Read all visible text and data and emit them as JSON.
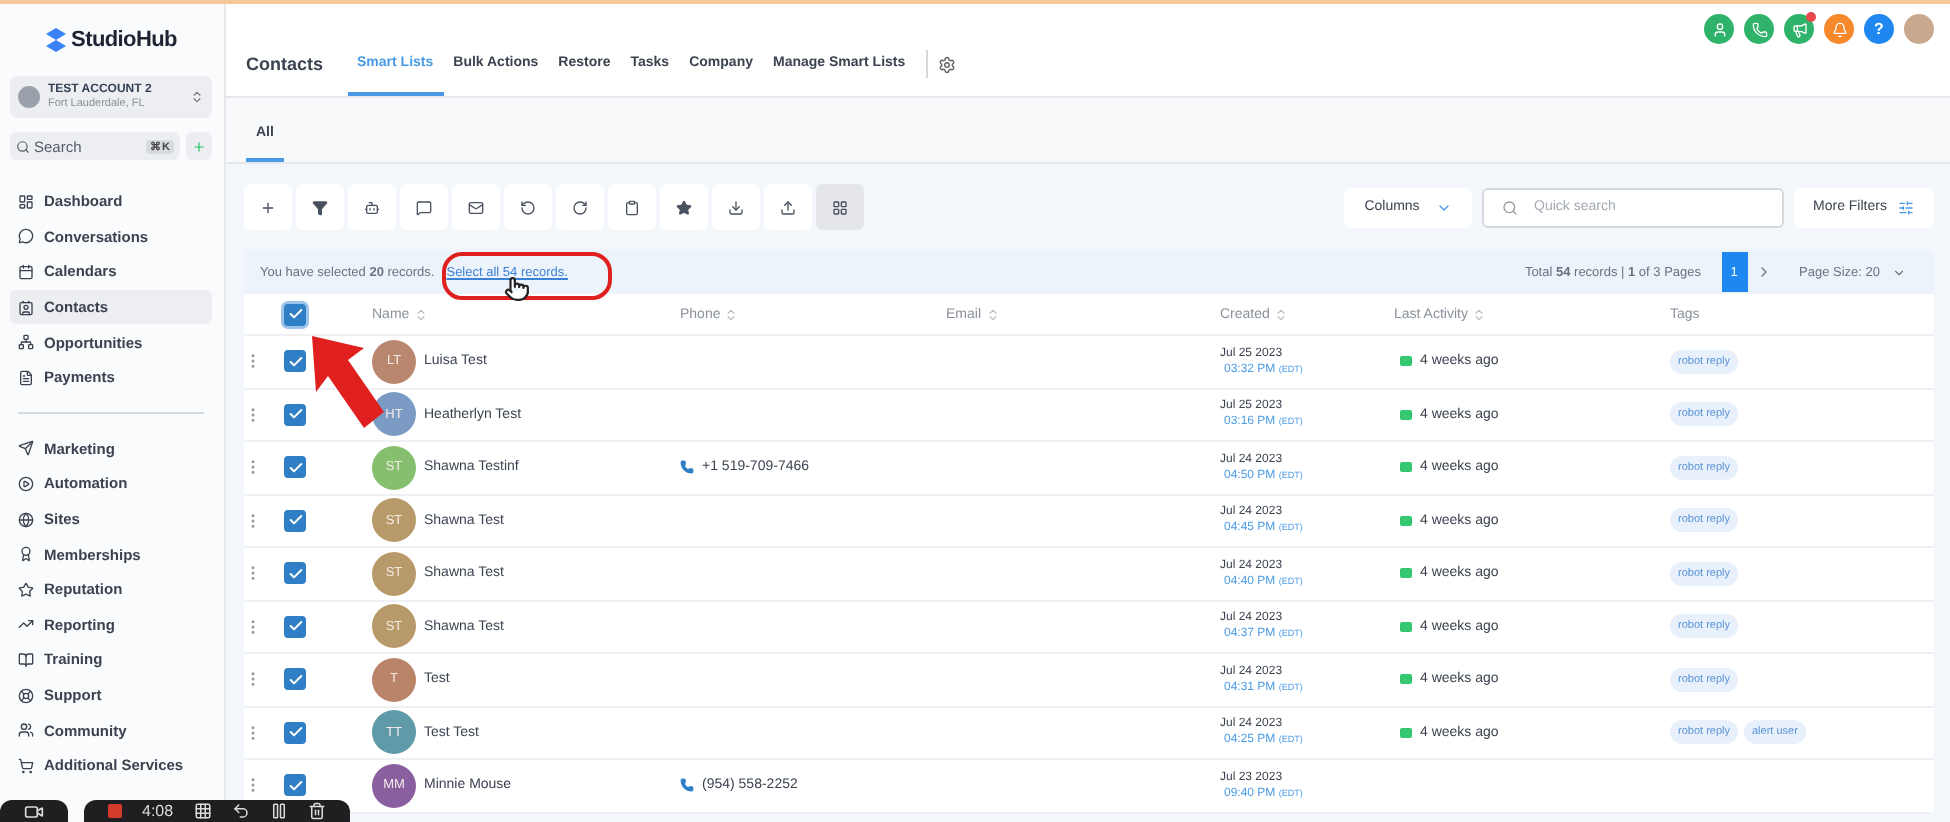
{
  "sidebar": {
    "brand": "StudioHub",
    "account": {
      "name": "TEST ACCOUNT 2",
      "location": "Fort Lauderdale, FL"
    },
    "search": {
      "placeholder": "Search",
      "shortcut": "⌘K"
    },
    "items": [
      {
        "label": "Dashboard",
        "selected": false
      },
      {
        "label": "Conversations",
        "selected": false
      },
      {
        "label": "Calendars",
        "selected": false
      },
      {
        "label": "Contacts",
        "selected": true
      },
      {
        "label": "Opportunities",
        "selected": false
      },
      {
        "label": "Payments",
        "selected": false
      }
    ],
    "items_2": [
      {
        "label": "Marketing",
        "selected": false
      },
      {
        "label": "Automation",
        "selected": false
      },
      {
        "label": "Sites",
        "selected": false
      },
      {
        "label": "Memberships",
        "selected": false
      },
      {
        "label": "Reputation",
        "selected": false
      },
      {
        "label": "Reporting",
        "selected": false
      },
      {
        "label": "Training",
        "selected": false
      },
      {
        "label": "Support",
        "selected": false
      },
      {
        "label": "Community",
        "selected": false
      },
      {
        "label": "Additional Services",
        "selected": false
      }
    ]
  },
  "header": {
    "title": "Contacts",
    "help": "?",
    "tabs": [
      {
        "label": "Smart Lists",
        "selected": true
      },
      {
        "label": "Bulk Actions",
        "selected": false
      },
      {
        "label": "Restore",
        "selected": false
      },
      {
        "label": "Tasks",
        "selected": false
      },
      {
        "label": "Company",
        "selected": false
      },
      {
        "label": "Manage Smart Lists",
        "selected": false
      }
    ]
  },
  "subtabs": [
    {
      "label": "All",
      "selected": true
    }
  ],
  "toolbar": {
    "actions": [
      {
        "selected": false
      },
      {
        "selected": false
      },
      {
        "selected": false
      },
      {
        "selected": false
      },
      {
        "selected": false
      },
      {
        "selected": false
      },
      {
        "selected": false
      },
      {
        "selected": false
      },
      {
        "selected": false
      },
      {
        "selected": false
      },
      {
        "selected": false
      },
      {
        "selected": true
      }
    ],
    "columns": "Columns",
    "search_placeholder": "Quick search",
    "more_filters": "More Filters"
  },
  "selection": {
    "text": "You have selected **20** records.",
    "link": "Select all 54 records.",
    "summary": "Total **54** records | **1** of 3 Pages",
    "pages": [
      {
        "label": "1",
        "selected": true
      }
    ],
    "page_size": "Page Size: 20"
  },
  "table": {
    "all_checked": true,
    "columns": [
      "Name",
      "Phone",
      "Email",
      "Created",
      "Last Activity",
      "Tags"
    ],
    "rows": [
      {
        "initials": "LT",
        "color": "#b9876e",
        "name": "Luisa Test",
        "phone": "",
        "date": "Jul 25 2023",
        "time": "03:32 PM",
        "tz": "(EDT)",
        "activity": "4 weeks ago",
        "tags": [
          "robot reply"
        ],
        "checked": true
      },
      {
        "initials": "HT",
        "color": "#7c9bc4",
        "name": "Heatherlyn Test",
        "phone": "",
        "date": "Jul 25 2023",
        "time": "03:16 PM",
        "tz": "(EDT)",
        "activity": "4 weeks ago",
        "tags": [
          "robot reply"
        ],
        "checked": true
      },
      {
        "initials": "ST",
        "color": "#86bf6e",
        "name": "Shawna Testinf",
        "phone": "+1 519-709-7466",
        "date": "Jul 24 2023",
        "time": "04:50 PM",
        "tz": "(EDT)",
        "activity": "4 weeks ago",
        "tags": [
          "robot reply"
        ],
        "checked": true
      },
      {
        "initials": "ST",
        "color": "#b89a6a",
        "name": "Shawna Test",
        "phone": "",
        "date": "Jul 24 2023",
        "time": "04:45 PM",
        "tz": "(EDT)",
        "activity": "4 weeks ago",
        "tags": [
          "robot reply"
        ],
        "checked": true
      },
      {
        "initials": "ST",
        "color": "#b89a6a",
        "name": "Shawna Test",
        "phone": "",
        "date": "Jul 24 2023",
        "time": "04:40 PM",
        "tz": "(EDT)",
        "activity": "4 weeks ago",
        "tags": [
          "robot reply"
        ],
        "checked": true
      },
      {
        "initials": "ST",
        "color": "#b89a6a",
        "name": "Shawna Test",
        "phone": "",
        "date": "Jul 24 2023",
        "time": "04:37 PM",
        "tz": "(EDT)",
        "activity": "4 weeks ago",
        "tags": [
          "robot reply"
        ],
        "checked": true
      },
      {
        "initials": "T",
        "color": "#b98467",
        "name": "Test",
        "phone": "",
        "date": "Jul 24 2023",
        "time": "04:31 PM",
        "tz": "(EDT)",
        "activity": "4 weeks ago",
        "tags": [
          "robot reply"
        ],
        "checked": true
      },
      {
        "initials": "TT",
        "color": "#5f9aa8",
        "name": "Test Test",
        "phone": "",
        "date": "Jul 24 2023",
        "time": "04:25 PM",
        "tz": "(EDT)",
        "activity": "4 weeks ago",
        "tags": [
          "robot reply",
          "alert user"
        ],
        "checked": true
      },
      {
        "initials": "MM",
        "color": "#8a5fa0",
        "name": "Minnie Mouse",
        "phone": "(954) 558-2252",
        "date": "Jul 23 2023",
        "time": "09:40 PM",
        "tz": "(EDT)",
        "activity": "",
        "tags": [],
        "checked": true
      }
    ]
  },
  "recorder": {
    "time": "4:08"
  }
}
